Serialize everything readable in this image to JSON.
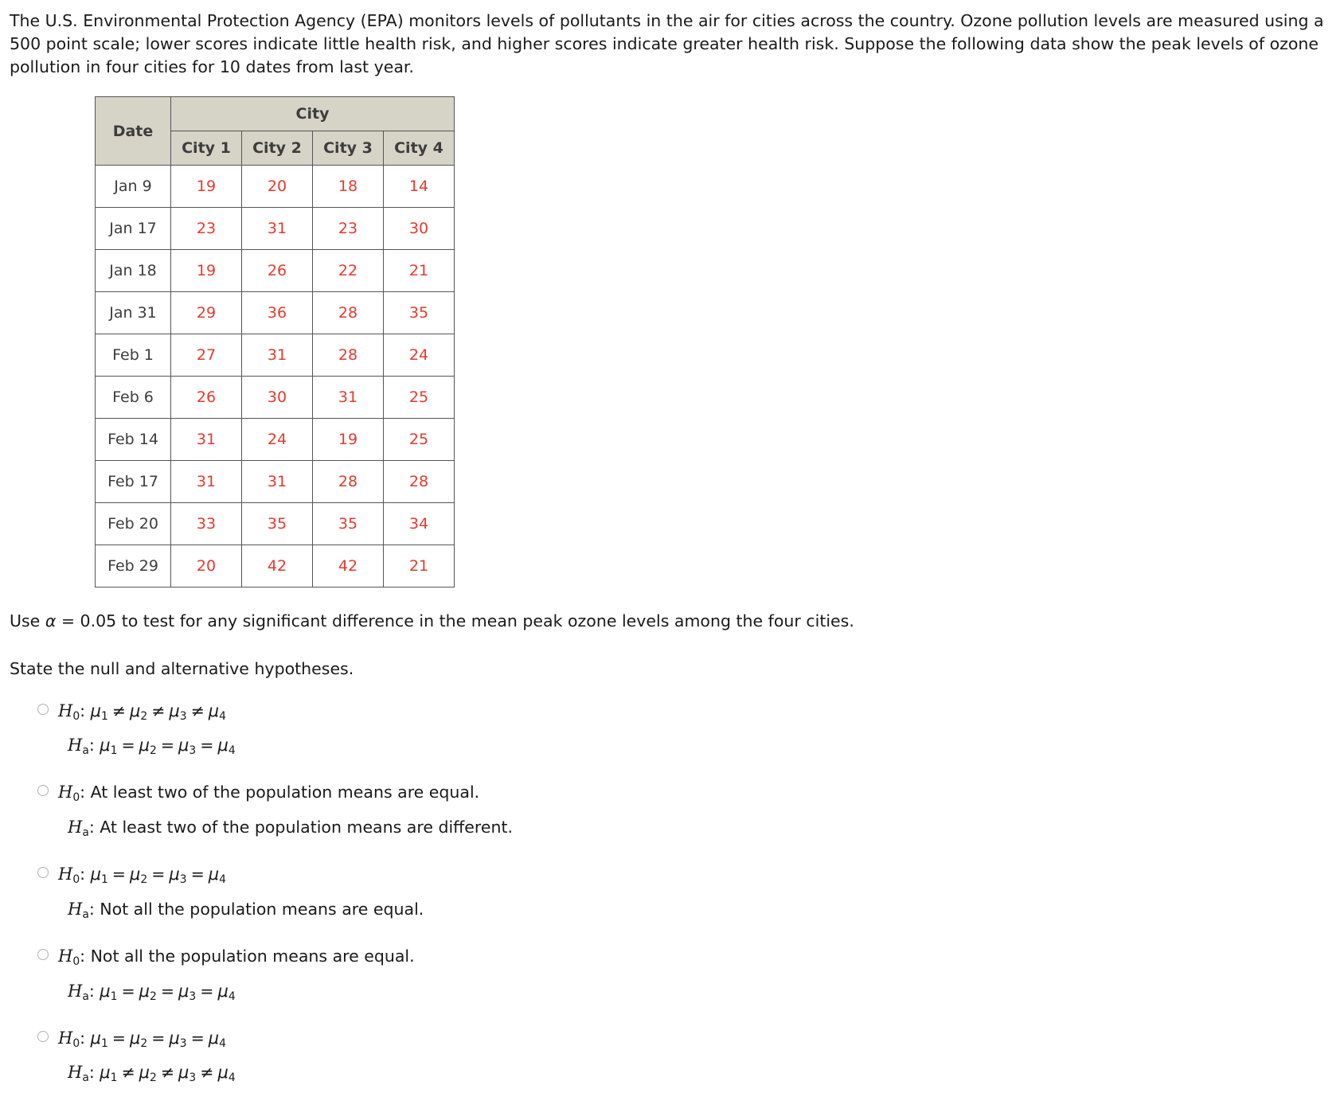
{
  "intro": {
    "paragraph": "The U.S. Environmental Protection Agency (EPA) monitors levels of pollutants in the air for cities across the country. Ozone pollution levels are measured using a 500 point scale; lower scores indicate little health risk, and higher scores indicate greater health risk. Suppose the following data show the peak levels of ozone pollution in four cities for 10 dates from last year."
  },
  "table": {
    "date_header": "Date",
    "group_header": "City",
    "columns": [
      "City 1",
      "City 2",
      "City 3",
      "City 4"
    ],
    "rows": [
      {
        "date": "Jan 9",
        "values": [
          "19",
          "20",
          "18",
          "14"
        ]
      },
      {
        "date": "Jan 17",
        "values": [
          "23",
          "31",
          "23",
          "30"
        ]
      },
      {
        "date": "Jan 18",
        "values": [
          "19",
          "26",
          "22",
          "21"
        ]
      },
      {
        "date": "Jan 31",
        "values": [
          "29",
          "36",
          "28",
          "35"
        ]
      },
      {
        "date": "Feb 1",
        "values": [
          "27",
          "31",
          "28",
          "24"
        ]
      },
      {
        "date": "Feb 6",
        "values": [
          "26",
          "30",
          "31",
          "25"
        ]
      },
      {
        "date": "Feb 14",
        "values": [
          "31",
          "24",
          "19",
          "25"
        ]
      },
      {
        "date": "Feb 17",
        "values": [
          "31",
          "31",
          "28",
          "28"
        ]
      },
      {
        "date": "Feb 20",
        "values": [
          "33",
          "35",
          "35",
          "34"
        ]
      },
      {
        "date": "Feb 29",
        "values": [
          "20",
          "42",
          "42",
          "21"
        ]
      }
    ],
    "header_bg": "#d6d3c7",
    "value_color": "#e8392e"
  },
  "prompts": {
    "use_alpha_prefix": "Use ",
    "use_alpha_symbol": "α",
    "use_alpha_rest": " = 0.05 to test for any significant difference in the mean peak ozone levels among the four cities.",
    "state_hypotheses": "State the null and alternative hypotheses."
  },
  "options": [
    {
      "id": "option-1",
      "null_label": "H",
      "null_sub": "0",
      "null_text_kind": "math-neq",
      "alt_label": "H",
      "alt_sub": "a",
      "alt_text_kind": "math-eq",
      "null_plain": "",
      "alt_plain": ""
    },
    {
      "id": "option-2",
      "null_label": "H",
      "null_sub": "0",
      "null_text_kind": "plain",
      "alt_label": "H",
      "alt_sub": "a",
      "alt_text_kind": "plain",
      "null_plain": ": At least two of the population means are equal.",
      "alt_plain": ": At least two of the population means are different."
    },
    {
      "id": "option-3",
      "null_label": "H",
      "null_sub": "0",
      "null_text_kind": "math-eq",
      "alt_label": "H",
      "alt_sub": "a",
      "alt_text_kind": "plain",
      "null_plain": "",
      "alt_plain": ": Not all the population means are equal."
    },
    {
      "id": "option-4",
      "null_label": "H",
      "null_sub": "0",
      "null_text_kind": "plain",
      "alt_label": "H",
      "alt_sub": "a",
      "alt_text_kind": "math-eq",
      "null_plain": ": Not all the population means are equal.",
      "alt_plain": ""
    },
    {
      "id": "option-5",
      "null_label": "H",
      "null_sub": "0",
      "null_text_kind": "math-eq",
      "alt_label": "H",
      "alt_sub": "a",
      "alt_text_kind": "math-neq",
      "null_plain": "",
      "alt_plain": ""
    }
  ],
  "math": {
    "mu": "μ",
    "eq": "=",
    "neq": "≠",
    "colon": ":",
    "subs": [
      "1",
      "2",
      "3",
      "4"
    ]
  }
}
